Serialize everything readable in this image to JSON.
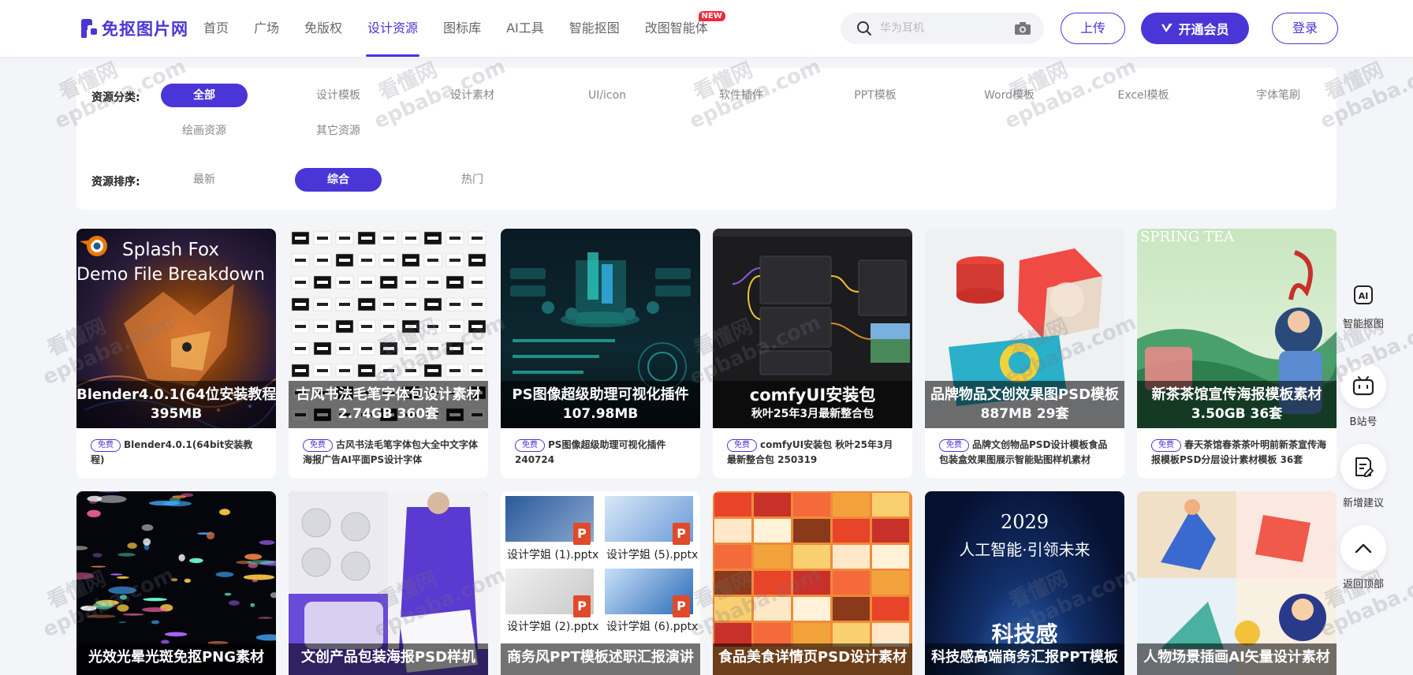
{
  "header": {
    "logo_text": "免抠图片网",
    "nav": [
      {
        "label": "首页"
      },
      {
        "label": "广场"
      },
      {
        "label": "免版权"
      },
      {
        "label": "设计资源",
        "active": true
      },
      {
        "label": "图标库"
      },
      {
        "label": "AI工具"
      },
      {
        "label": "智能抠图"
      },
      {
        "label": "改图智能体",
        "badge": "NEW"
      }
    ],
    "search_placeholder": "华为耳机",
    "upload_label": "上传",
    "vip_label": "开通会员",
    "login_label": "登录"
  },
  "filter": {
    "category_label": "资源分类:",
    "categories": [
      "全部",
      "设计模板",
      "设计素材",
      "UI/icon",
      "软件插件",
      "PPT模板",
      "Word模板",
      "Excel模板",
      "字体笔刷",
      "绘画资源",
      "其它资源"
    ],
    "category_active": "全部",
    "sort_label": "资源排序:",
    "sorts": [
      "最新",
      "综合",
      "热门"
    ],
    "sort_active": "综合"
  },
  "free_badge": "免费",
  "cards_row1": [
    {
      "thumb_text_1": "Splash Fox",
      "thumb_text_2": "Demo File Breakdown",
      "title": "Blender4.0.1(64位安装教程)",
      "sub": "395MB",
      "desc": "Blender4.0.1(64bit安装教程)"
    },
    {
      "title": "古风书法毛笔字体包设计素材",
      "sub": "2.74GB 360套",
      "desc": "古风书法毛笔字体包大全中文字体海报广告AI平面PS设计字体"
    },
    {
      "title": "PS图像超级助理可视化插件",
      "sub": "107.98MB",
      "desc": "PS图像超级助理可视化插件 240724"
    },
    {
      "title": "comfyUI安装包",
      "sub": "秋叶25年3月最新整合包",
      "desc": "comfyUI安装包 秋叶25年3月最新整合包 250319"
    },
    {
      "title": "品牌物品文创效果图PSD模板",
      "sub": "887MB 29套",
      "desc": "品牌文创物品PSD设计模板食品包装盒效果图展示智能贴图样机素材"
    },
    {
      "title": "新茶茶馆宣传海报模板素材",
      "sub": "3.50GB 36套",
      "desc": "春天茶馆春茶茶叶明前新茶宣传海报模板PSD分层设计素材模板 36套"
    }
  ],
  "cards_row2": [
    {
      "title": "光效光晕光斑免抠PNG素材"
    },
    {
      "title": "文创产品包装海报PSD样机"
    },
    {
      "title": "商务风PPT模板述职汇报演讲",
      "files": [
        "设计学姐 (1).pptx",
        "设计学姐 (5).pptx",
        "设计学姐 (2).pptx",
        "设计学姐 (6).pptx"
      ]
    },
    {
      "title": "食品美食详情页PSD设计素材"
    },
    {
      "title": "科技感高端商务汇报PPT模板",
      "year": "2029",
      "line": "人工智能·引领未来",
      "tech": "科技感"
    },
    {
      "title": "人物场景插画AI矢量设计素材"
    }
  ],
  "rail": [
    {
      "label": "智能抠图",
      "icon": "ai-icon"
    },
    {
      "label": "B站号",
      "icon": "bilibili-icon"
    },
    {
      "label": "新增建议",
      "icon": "suggest-icon"
    },
    {
      "label": "返回顶部",
      "icon": "arrow-up-icon"
    }
  ],
  "watermark": {
    "cn": "看懂网",
    "en": "epbaba.com"
  },
  "colors": {
    "brand": "#4a36d6",
    "new_badge": "#f0283c"
  }
}
